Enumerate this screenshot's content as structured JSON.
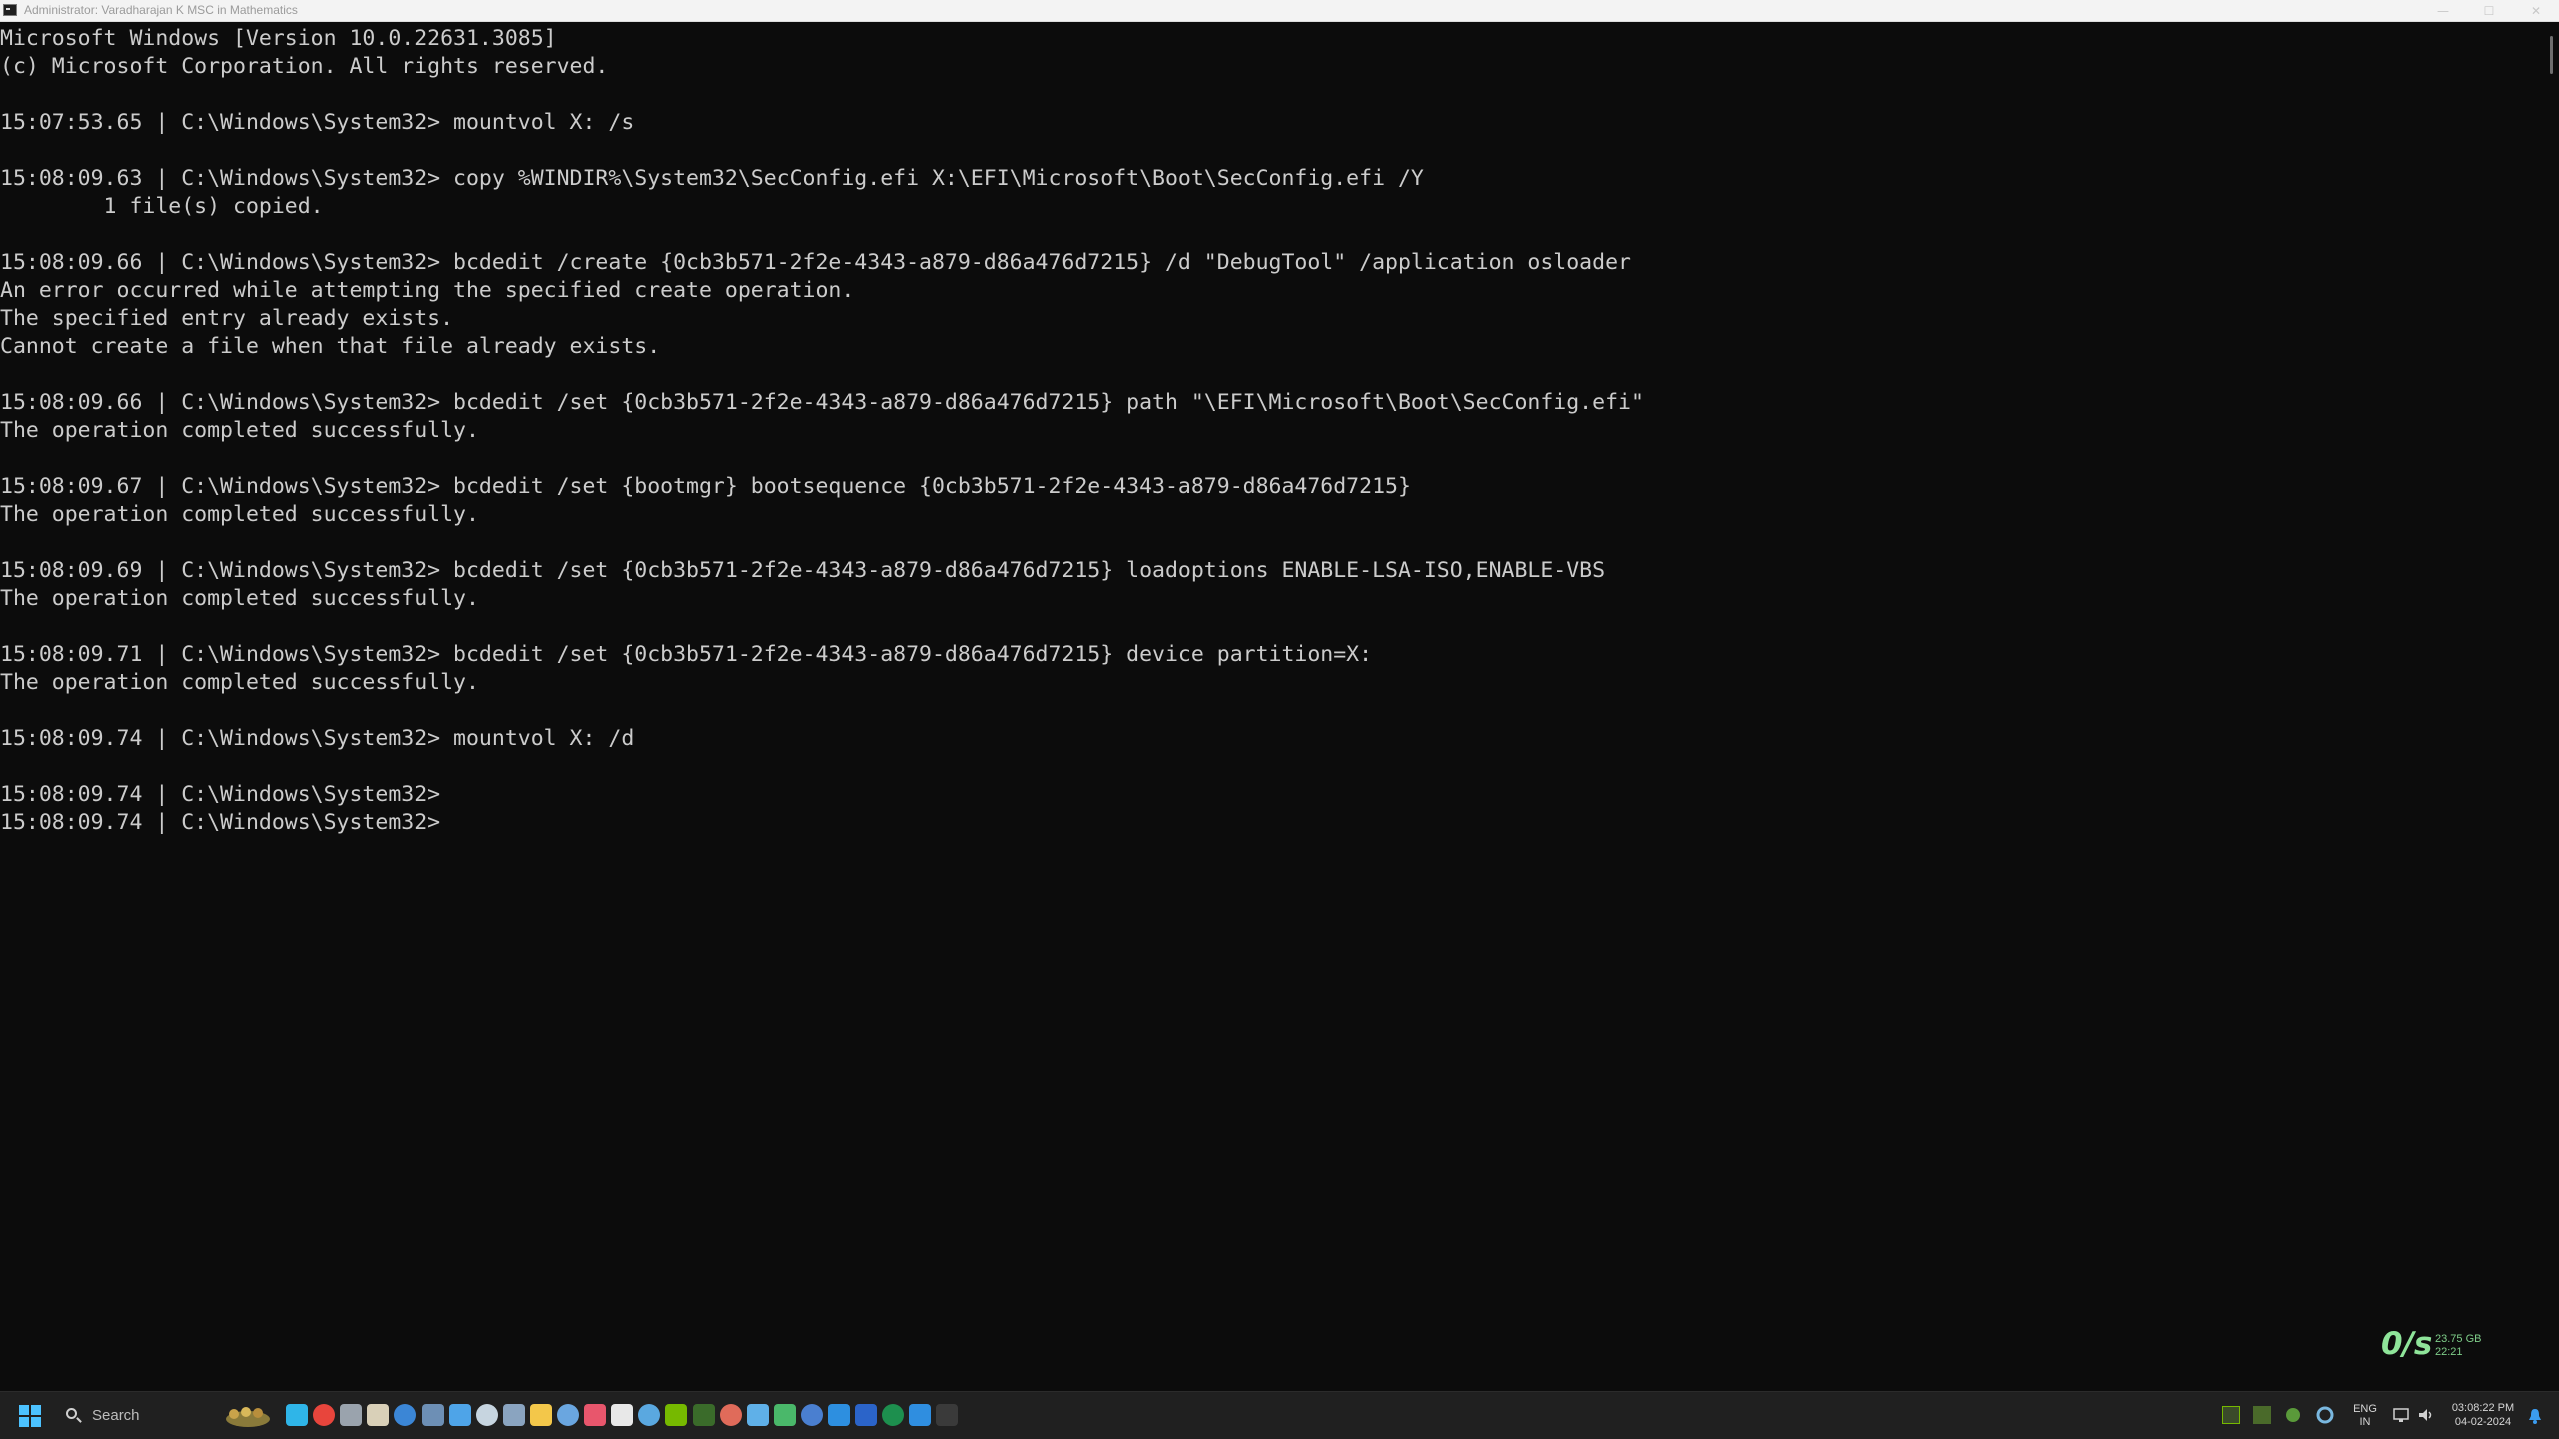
{
  "window": {
    "title": "Administrator: Varadharajan K MSC in  Mathematics",
    "controls": {
      "minimize": "—",
      "maximize": "☐",
      "close": "✕"
    }
  },
  "console": {
    "lines": [
      "Microsoft Windows [Version 10.0.22631.3085]",
      "(c) Microsoft Corporation. All rights reserved.",
      "",
      "15:07:53.65 | C:\\Windows\\System32> mountvol X: /s",
      "",
      "15:08:09.63 | C:\\Windows\\System32> copy %WINDIR%\\System32\\SecConfig.efi X:\\EFI\\Microsoft\\Boot\\SecConfig.efi /Y",
      "        1 file(s) copied.",
      "",
      "15:08:09.66 | C:\\Windows\\System32> bcdedit /create {0cb3b571-2f2e-4343-a879-d86a476d7215} /d \"DebugTool\" /application osloader",
      "An error occurred while attempting the specified create operation.",
      "The specified entry already exists.",
      "Cannot create a file when that file already exists.",
      "",
      "15:08:09.66 | C:\\Windows\\System32> bcdedit /set {0cb3b571-2f2e-4343-a879-d86a476d7215} path \"\\EFI\\Microsoft\\Boot\\SecConfig.efi\"",
      "The operation completed successfully.",
      "",
      "15:08:09.67 | C:\\Windows\\System32> bcdedit /set {bootmgr} bootsequence {0cb3b571-2f2e-4343-a879-d86a476d7215}",
      "The operation completed successfully.",
      "",
      "15:08:09.69 | C:\\Windows\\System32> bcdedit /set {0cb3b571-2f2e-4343-a879-d86a476d7215} loadoptions ENABLE-LSA-ISO,ENABLE-VBS",
      "The operation completed successfully.",
      "",
      "15:08:09.71 | C:\\Windows\\System32> bcdedit /set {0cb3b571-2f2e-4343-a879-d86a476d7215} device partition=X:",
      "The operation completed successfully.",
      "",
      "15:08:09.74 | C:\\Windows\\System32> mountvol X: /d",
      "",
      "15:08:09.74 | C:\\Windows\\System32>",
      "15:08:09.74 | C:\\Windows\\System32>"
    ]
  },
  "net_widget": {
    "speed": "0/s",
    "total": "23.75 GB",
    "time": "22:21"
  },
  "taskbar": {
    "search_placeholder": "Search",
    "apps": [
      {
        "name": "edge-icon",
        "color": "#2fb5e8"
      },
      {
        "name": "chrome-icon",
        "color": "#e8453c"
      },
      {
        "name": "settings-icon",
        "color": "#9aa3ad"
      },
      {
        "name": "clock-icon",
        "color": "#d9d0b8"
      },
      {
        "name": "store-icon",
        "color": "#3b86d6"
      },
      {
        "name": "photos-icon",
        "color": "#6d8fb5"
      },
      {
        "name": "copilot-icon",
        "color": "#4ea4e8"
      },
      {
        "name": "steam-icon",
        "color": "#c7d5e0"
      },
      {
        "name": "magnifier-icon",
        "color": "#8aa4c0"
      },
      {
        "name": "file-explorer-icon",
        "color": "#f3c74a"
      },
      {
        "name": "rstudio-icon",
        "color": "#6aa6e0"
      },
      {
        "name": "snipping-tool-icon",
        "color": "#e8566c"
      },
      {
        "name": "media-player-icon",
        "color": "#e8e8e8"
      },
      {
        "name": "mail-icon",
        "color": "#5aa8e0"
      },
      {
        "name": "nvidia-icon",
        "color": "#76b900"
      },
      {
        "name": "gpu-tool-icon",
        "color": "#3a6b2a"
      },
      {
        "name": "volume-mixer-icon",
        "color": "#e06b5a"
      },
      {
        "name": "notepad-icon",
        "color": "#5fb0e8"
      },
      {
        "name": "globe-icon",
        "color": "#4ab86a"
      },
      {
        "name": "powershell-icon",
        "color": "#4a7fd0"
      },
      {
        "name": "remote-desktop-icon",
        "color": "#2d8fe0"
      },
      {
        "name": "word-icon",
        "color": "#2b64c9"
      },
      {
        "name": "excel-icon",
        "color": "#1d8f4e"
      },
      {
        "name": "powerautomate-icon",
        "color": "#2f8ee0"
      },
      {
        "name": "terminal-icon",
        "color": "#3a3a3a"
      }
    ],
    "tray": {
      "lang_top": "ENG",
      "lang_bottom": "IN",
      "time": "03:08:22 PM",
      "date": "04-02-2024"
    }
  }
}
